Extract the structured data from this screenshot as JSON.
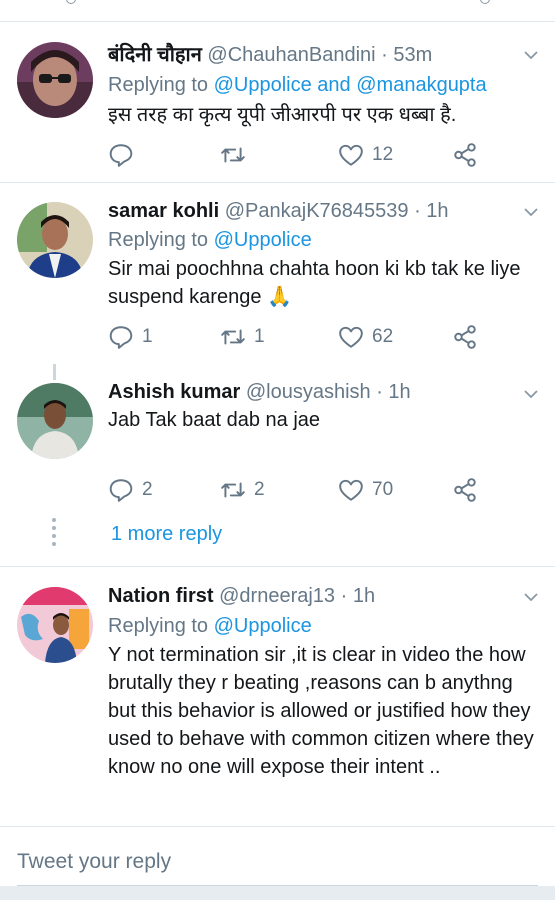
{
  "tweets": [
    {
      "name": "बंदिनी चौहान",
      "handle": "@ChauhanBandini",
      "time": "· 53m",
      "replying_label": "Replying to ",
      "replying_to": "@Uppolice and @manakgupta",
      "text": "इस तरह का कृत्य यूपी जीआरपी पर एक धब्बा है.",
      "replies": "",
      "retweets": "",
      "likes": "12"
    },
    {
      "name": "samar kohli",
      "handle": "@PankajK76845539",
      "time": "· 1h",
      "replying_label": "Replying to ",
      "replying_to": "@Uppolice",
      "text": "Sir mai poochhna chahta hoon ki kb tak ke liye suspend karenge 🙏",
      "replies": "1",
      "retweets": "1",
      "likes": "62"
    },
    {
      "name": "Ashish kumar",
      "handle": "@lousyashish",
      "time": "· 1h",
      "text": "Jab Tak baat dab na jae",
      "replies": "2",
      "retweets": "2",
      "likes": "70"
    },
    {
      "name": "Nation first",
      "handle": "@drneeraj13",
      "time": "· 1h",
      "replying_label": "Replying to ",
      "replying_to": "@Uppolice",
      "text": "Y not termination sir ,it is clear in video the how brutally they r beating ,reasons can b anythng but this behavior is allowed or justified how they used to behave with common citizen where they know no one will expose their intent .."
    }
  ],
  "more_replies": "1 more reply",
  "composer": {
    "placeholder": "Tweet your reply"
  },
  "colors": {
    "accent": "#1b95e0",
    "muted": "#657786",
    "border": "#e1e8ed"
  },
  "icons": [
    "reply-icon",
    "retweet-icon",
    "like-icon",
    "share-icon",
    "chevron-down-icon"
  ]
}
